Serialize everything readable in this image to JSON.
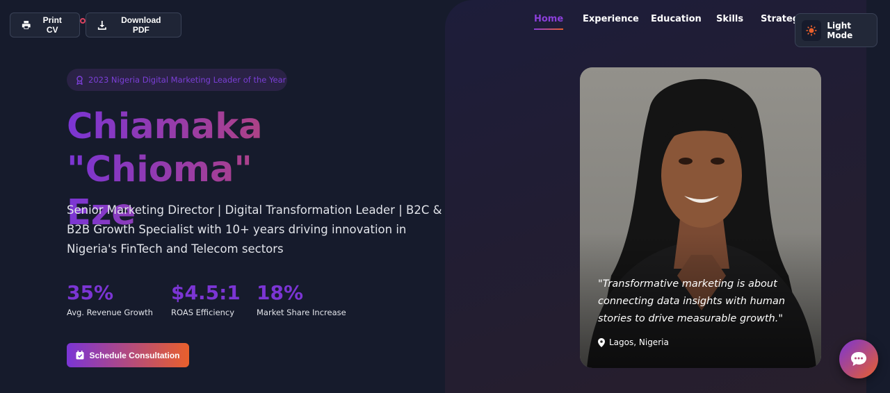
{
  "toolbar": {
    "print_label": "Print CV",
    "download_label": "Download PDF"
  },
  "nav": {
    "items": [
      {
        "label": "Home",
        "active": true
      },
      {
        "label": "Experience"
      },
      {
        "label": "Education"
      },
      {
        "label": "Skills"
      },
      {
        "label": "Strategy"
      }
    ],
    "theme_toggle": "Light Mode"
  },
  "hero": {
    "award": "2023 Nigeria Digital Marketing Leader of the Year",
    "name_line1": "Chiamaka \"Chioma\"",
    "name_line2": "Eze",
    "tagline": "Senior Marketing Director | Digital Transformation Leader | B2C & B2B Growth Specialist with 10+ years driving innovation in Nigeria's FinTech and Telecom sectors",
    "stats": [
      {
        "value": "35%",
        "label": "Avg. Revenue Growth"
      },
      {
        "value": "$4.5:1",
        "label": "ROAS Efficiency"
      },
      {
        "value": "18%",
        "label": "Market Share Increase"
      }
    ],
    "cta_label": "Schedule Consultation"
  },
  "profile": {
    "quote": "\"Transformative marketing is about connecting data insights with human stories to drive measurable growth.\"",
    "location": "Lagos, Nigeria"
  },
  "colors": {
    "accent_purple": "#7b35d4",
    "accent_orange": "#e8602c",
    "background": "#161b2c"
  },
  "icons": [
    "printer-icon",
    "download-icon",
    "sun-icon",
    "award-icon",
    "calendar-check-icon",
    "map-pin-icon",
    "chat-icon"
  ]
}
